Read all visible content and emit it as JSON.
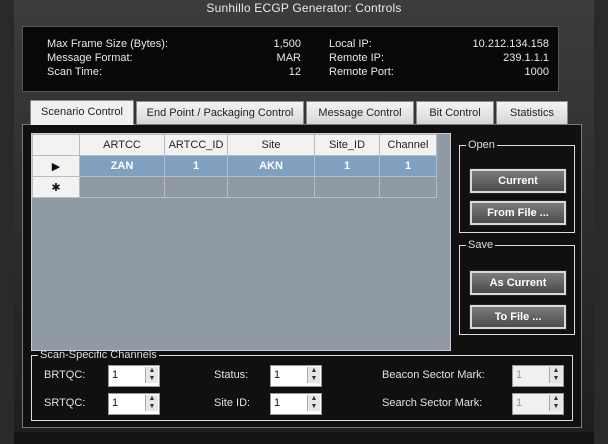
{
  "title": "Sunhillo ECGP Generator: Controls",
  "info": {
    "max_frame_label": "Max Frame Size (Bytes):",
    "max_frame_value": "1,500",
    "message_format_label": "Message Format:",
    "message_format_value": "MAR",
    "scan_time_label": "Scan Time:",
    "scan_time_value": "12",
    "local_ip_label": "Local IP:",
    "local_ip_value": "10.212.134.158",
    "remote_ip_label": "Remote IP:",
    "remote_ip_value": "239.1.1.1",
    "remote_port_label": "Remote Port:",
    "remote_port_value": "1000"
  },
  "tabs": [
    "Scenario Control",
    "End Point / Packaging Control",
    "Message Control",
    "Bit Control",
    "Statistics"
  ],
  "grid": {
    "columns": [
      "ARTCC",
      "ARTCC_ID",
      "Site",
      "Site_ID",
      "Channel"
    ],
    "rows": [
      [
        "ZAN",
        "1",
        "AKN",
        "1",
        "1"
      ]
    ],
    "current_row_marker": "▶",
    "new_row_marker": "✱"
  },
  "open_group": {
    "legend": "Open",
    "current": "Current",
    "from_file": "From File ..."
  },
  "save_group": {
    "legend": "Save",
    "as_current": "As Current",
    "to_file": "To File ..."
  },
  "scan": {
    "legend": "Scan-Specific Channels",
    "brtqc_label": "BRTQC:",
    "brtqc_value": "1",
    "srtqc_label": "SRTQC:",
    "srtqc_value": "1",
    "status_label": "Status:",
    "status_value": "1",
    "siteid_label": "Site ID:",
    "siteid_value": "1",
    "beacon_label": "Beacon Sector Mark:",
    "beacon_value": "1",
    "search_label": "Search Sector Mark:",
    "search_value": "1"
  }
}
